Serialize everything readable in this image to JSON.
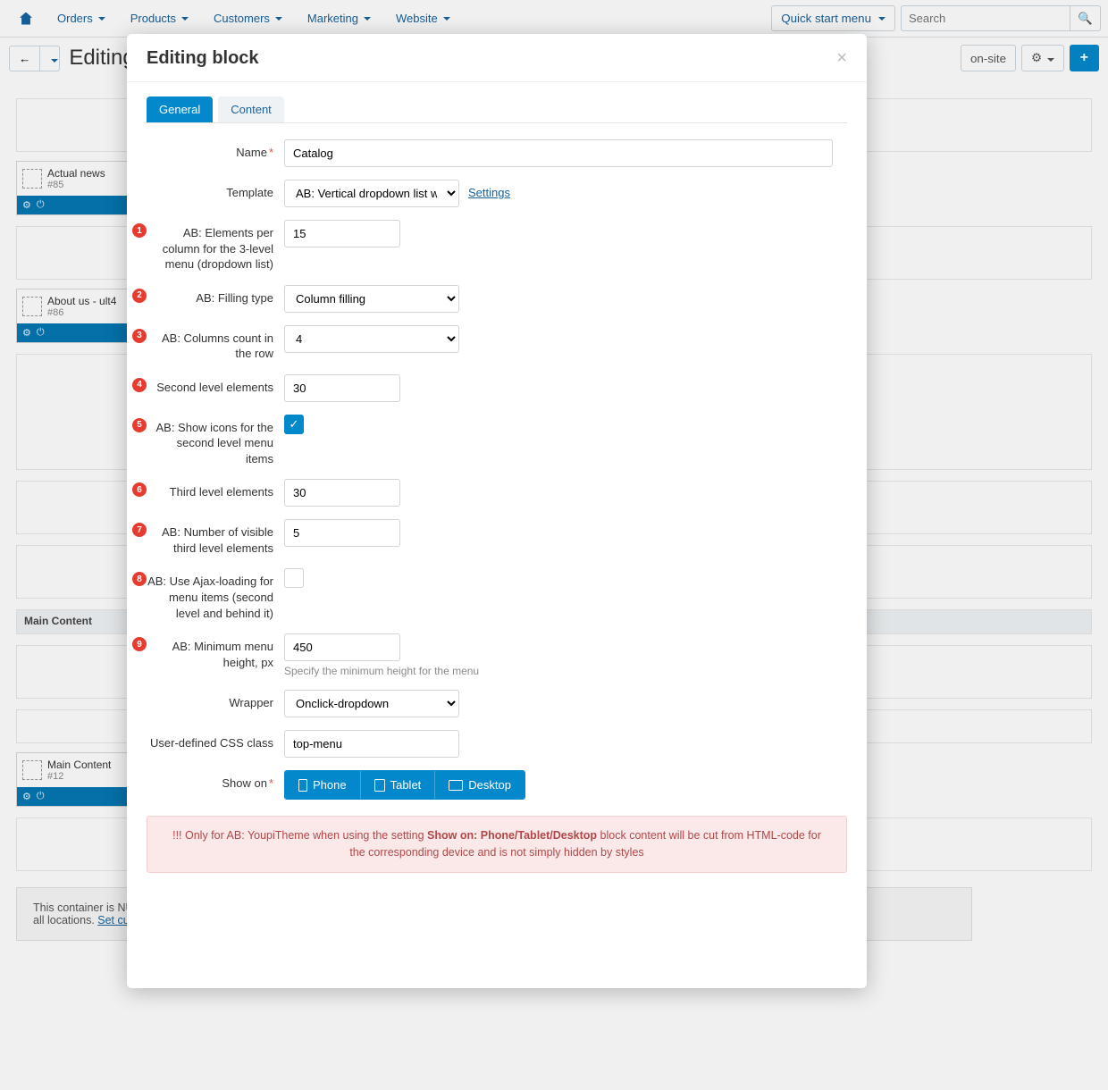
{
  "nav": {
    "orders": "Orders",
    "products": "Products",
    "customers": "Customers",
    "marketing": "Marketing",
    "website": "Website",
    "quick": "Quick start menu",
    "search_placeholder": "Search"
  },
  "page": {
    "title": "Editing",
    "preview": "on-site"
  },
  "blocks": {
    "actual": {
      "title": "Actual news",
      "id": "#85"
    },
    "about": {
      "title": "About us - ult4",
      "id": "#86"
    },
    "main_content_dup": "Main Content",
    "main": {
      "title": "Main Content",
      "id": "#12"
    },
    "notice_a": "This container is NU",
    "notice_b": "all locations. ",
    "notice_link": "Set cu"
  },
  "modal": {
    "title": "Editing block",
    "tabs": {
      "general": "General",
      "content": "Content"
    },
    "fields": {
      "name": {
        "label": "Name",
        "value": "Catalog"
      },
      "template": {
        "label": "Template",
        "value": "AB: Vertical dropdown list with icons",
        "link": "Settings"
      },
      "f1": {
        "label": "AB: Elements per column for the 3-level menu (dropdown list)",
        "value": "15"
      },
      "f2": {
        "label": "AB: Filling type",
        "value": "Column filling"
      },
      "f3": {
        "label": "AB: Columns count in the row",
        "value": "4"
      },
      "f4": {
        "label": "Second level elements",
        "value": "30"
      },
      "f5": {
        "label": "AB: Show icons for the second level menu items"
      },
      "f6": {
        "label": "Third level elements",
        "value": "30"
      },
      "f7": {
        "label": "AB: Number of visible third level elements",
        "value": "5"
      },
      "f8": {
        "label": "AB: Use Ajax-loading for menu items (second level and behind it)"
      },
      "f9": {
        "label": "AB: Minimum menu height, px",
        "value": "450",
        "hint": "Specify the minimum height for the menu"
      },
      "wrapper": {
        "label": "Wrapper",
        "value": "Onclick-dropdown"
      },
      "css": {
        "label": "User-defined CSS class",
        "value": "top-menu"
      },
      "showon": {
        "label": "Show on",
        "phone": "Phone",
        "tablet": "Tablet",
        "desktop": "Desktop"
      }
    },
    "alert_pre": "!!! Only for AB: YoupiTheme when using the setting ",
    "alert_bold": "Show on: Phone/Tablet/Desktop",
    "alert_post": " block content will be cut from HTML-code for the corresponding device and is not simply hidden by styles"
  },
  "nums": {
    "n1": "1",
    "n2": "2",
    "n3": "3",
    "n4": "4",
    "n5": "5",
    "n6": "6",
    "n7": "7",
    "n8": "8",
    "n9": "9"
  }
}
